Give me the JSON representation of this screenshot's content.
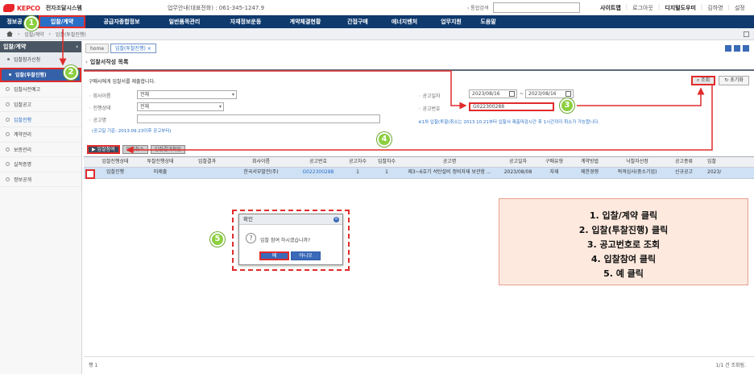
{
  "header": {
    "brand": "KEPCO",
    "system": "전자조달시스템",
    "helpline": "업무안내(대표전화) : 061-345-1247.9",
    "search_label": "› 통합검색",
    "links": [
      "사이트맵",
      "로그아웃",
      "디지털도우미",
      "김하영",
      "설정"
    ]
  },
  "nav": {
    "items": [
      "정보공",
      "입찰/계약",
      "공급자종합정보",
      "일반품목관리",
      "자재정보운동",
      "계약체결현황",
      "간접구매",
      "에너지벤처",
      "업무지원",
      "도움말"
    ]
  },
  "breadcrumb": [
    "입찰/계약",
    "입찰(투찰진행)"
  ],
  "sidebar": {
    "title": "입찰/계약",
    "items": [
      {
        "label": "입찰참가신청",
        "type": "sub"
      },
      {
        "label": "입찰(투찰진행)",
        "type": "current"
      },
      {
        "label": "입찰사전예고",
        "type": "normal"
      },
      {
        "label": "입찰공고",
        "type": "normal"
      },
      {
        "label": "입찰진행",
        "type": "hl"
      },
      {
        "label": "계약관리",
        "type": "normal"
      },
      {
        "label": "보증관리",
        "type": "normal"
      },
      {
        "label": "실적증명",
        "type": "normal"
      },
      {
        "label": "정보공개",
        "type": "normal"
      }
    ]
  },
  "tabs": [
    "home",
    "입찰(투찰진행)"
  ],
  "section_title": "입찰서작성 목록",
  "form": {
    "description": "구매사에게 입찰서를 제출합니다.",
    "company_label": "회사이름",
    "company_value": "전체",
    "status_label": "진행상태",
    "status_value": "전체",
    "notice_name_label": "공고명",
    "notice_name_value": "",
    "date_label": "공고일자",
    "date_from": "2023/08/16",
    "date_tilde": "~",
    "date_to": "2023/08/16",
    "notice_no_label": "공고번호",
    "notice_no_value": "G022300288",
    "notice": "※1차 입찰(투찰)취소는 2013.10.21부터 입찰서 제출마감시간 후 1시간까지 취소가 가능합니다.",
    "subnote": "(공고일 기준: 2013.09.23이후 공고부터)",
    "search_button": "조회",
    "reset_button": "초기화"
  },
  "actions": [
    "입찰참여",
    "입찰취소",
    "입찰결과확인"
  ],
  "grid": {
    "columns": [
      "",
      "입찰진행상태",
      "투찰진행상태",
      "입찰결과",
      "회사이름",
      "공고번호",
      "공고차수",
      "입찰차수",
      "공고명",
      "공고일자",
      "구매유형",
      "계약방법",
      "낙찰자선정",
      "공고종류",
      "입찰"
    ],
    "row": [
      "",
      "입찰진행",
      "미제출",
      "",
      "한국서부발전(주)",
      "G022300288",
      "1",
      "1",
      "제3~6호기 석탄설비 정비자재 보관함 ...",
      "2023/08/08",
      "자재",
      "제한경쟁",
      "적격심사(중소기업)",
      "신규공고",
      "2023/"
    ],
    "footer_left": "행 1",
    "footer_right": "1/1 건 조회됨."
  },
  "dialog": {
    "title": "확인",
    "message": "입찰 참여 하시겠습니까?",
    "yes": "예",
    "no": "아니오"
  },
  "steps": [
    "1. 입찰/계약 클릭",
    "2. 입찰(투찰진행) 클릭",
    "3. 공고번호로 조회",
    "4. 입찰참여 클릭",
    "5. 예 클릭"
  ],
  "badges": [
    "1",
    "2",
    "3",
    "4",
    "5"
  ],
  "colors": {
    "accent": "#e02b2b",
    "nav": "#0e3a6e",
    "badge": "#8ccf3f",
    "link": "#2a6fc7"
  }
}
